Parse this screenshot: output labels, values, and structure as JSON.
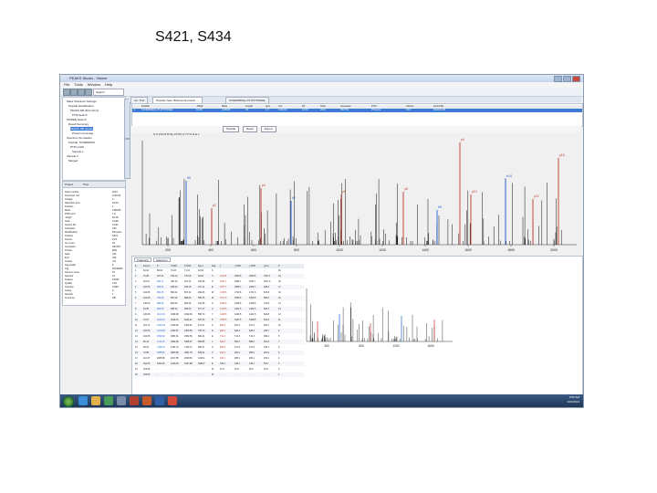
{
  "slide": {
    "title": "S421, S434"
  },
  "window": {
    "title": "PEAKS Studio - Viewer"
  },
  "menu": [
    "File",
    "Tools",
    "Window",
    "Help"
  ],
  "toolbar": {
    "search_placeholder": "Search"
  },
  "tabs": {
    "left": [
      "Summary",
      "Protein",
      "Peptide"
    ],
    "main": [
      "Ion: Prot",
      "Peptide View: Ribosomal protein ...",
      "SVHEMMSA(+79.97)YPKEEL"
    ],
    "lower": [
      "Fragment",
      "Spectrum"
    ],
    "props": [
      "Project",
      "Prop"
    ]
  },
  "tree": [
    "Mass Tolerance Settings",
    "Peptide identification",
    "PEAKS DB 2014-10 [1]",
    "PTM Search",
    "SPIDER Search",
    "Result Summary",
    "PEAKS DB results",
    "Protein Coverage",
    "Spectrum Annotation",
    "Peptide: SVHEMMSA",
    "PTM profile",
    "Sample 1",
    "Sample 2",
    "Merged"
  ],
  "properties": [
    [
      "Scan number",
      "2012"
    ],
    [
      "Precursor m/z",
      "1100.92"
    ],
    [
      "Charge",
      "2"
    ],
    [
      "Retention time",
      "44.53"
    ],
    [
      "Fraction",
      "1"
    ],
    [
      "Mass",
      "2199.83"
    ],
    [
      "PPM error",
      "1.9"
    ],
    [
      "-10lgP",
      "62.48"
    ],
    [
      "Area",
      "4.1E6"
    ],
    [
      "Source file",
      "run01"
    ],
    [
      "Activation",
      "CID"
    ],
    [
      "Modification",
      "Phospho"
    ],
    [
      "Position",
      "S421"
    ],
    [
      "Ascore",
      "23.5"
    ],
    [
      "Ion count",
      "18"
    ],
    [
      "Accession",
      "P62753"
    ],
    [
      "Protein",
      "RS6"
    ],
    [
      "Start",
      "415"
    ],
    [
      "End",
      "434"
    ],
    [
      "Unique",
      "Yes"
    ],
    [
      "Tag length",
      "6"
    ],
    [
      "Tag",
      "SVHEMM"
    ],
    [
      "Denovo score",
      "87"
    ],
    [
      "Spectra",
      "12"
    ],
    [
      "Feature",
      "F2044"
    ],
    [
      "Quality",
      "0.91"
    ],
    [
      "Intensity",
      "2.6E5"
    ],
    [
      "Group",
      "A"
    ],
    [
      "Sample",
      "1"
    ],
    [
      "Found by",
      "DB"
    ]
  ],
  "table": {
    "headers": [
      "",
      "Peptide",
      "-10lgP",
      "Mass",
      "Length",
      "ppm",
      "m/z",
      "RT",
      "Scan",
      "Accession",
      "PTM",
      "AScore",
      "Found By"
    ],
    "selected_row": [
      "1",
      "SVHEMMSA(+79.97)YPKEEL",
      "62.48",
      "2199.83",
      "20",
      "1.9",
      "1100.92",
      "44.53",
      "2012",
      "P62753",
      "Phospho",
      "23.5",
      "PEAKS DB"
    ]
  },
  "spectrum_tools": {
    "btn1": "Peptide",
    "btn2": "Reset",
    "btn3": "Export"
  },
  "spectrum": {
    "sequence_text": "S V H E M M S(+79.97) A Y P K E E L",
    "axis_ticks": [
      "200",
      "400",
      "600",
      "800",
      "1000",
      "1200",
      "1400",
      "1600",
      "1800",
      "2000"
    ],
    "labels": {
      "y2": "y2",
      "b5": "b5",
      "y4": "y4",
      "b7": "b7",
      "y6": "y6",
      "y8": "y8",
      "b9": "b9",
      "y10": "y10",
      "y12": "y12",
      "b14": "b14",
      "y16": "y16",
      "ypeak": "y9"
    }
  },
  "fragment_table": {
    "headers": [
      "#",
      "Immon.",
      "b",
      "b-H2O",
      "b-NH3",
      "b(2+)",
      "Seq",
      "y",
      "y-H2O",
      "y-NH3",
      "y(2+)",
      "#"
    ],
    "rows": [
      [
        "1",
        "60.04",
        "88.04",
        "70.03",
        "71.01",
        "44.52",
        "S",
        "-",
        "-",
        "-",
        "-",
        "20"
      ],
      [
        "2",
        "72.08",
        "187.11",
        "169.10",
        "170.08",
        "94.06",
        "V",
        "2113.8",
        "2095.8",
        "2096.8",
        "1057.4",
        "19"
      ],
      [
        "3",
        "110.07",
        "324.17",
        "306.16",
        "307.14",
        "162.59",
        "H",
        "2014.7",
        "1996.7",
        "1997.7",
        "1007.9",
        "18"
      ],
      [
        "4",
        "102.05",
        "453.21",
        "435.20",
        "436.18",
        "227.11",
        "E",
        "1877.7",
        "1859.7",
        "1860.7",
        "939.3",
        "17"
      ],
      [
        "5",
        "104.05",
        "584.25",
        "566.24",
        "567.22",
        "292.63",
        "M",
        "1748.6",
        "1730.6",
        "1731.6",
        "874.8",
        "16"
      ],
      [
        "6",
        "104.05",
        "715.29",
        "697.28",
        "698.26",
        "358.15",
        "M",
        "1617.6",
        "1599.6",
        "1600.6",
        "809.3",
        "15"
      ],
      [
        "7",
        "140.00",
        "882.29",
        "864.28",
        "865.26",
        "441.65",
        "S",
        "1486.5",
        "1468.5",
        "1469.5",
        "743.8",
        "14"
      ],
      [
        "8",
        "44.05",
        "953.33",
        "935.32",
        "936.30",
        "477.17",
        "A",
        "1319.5",
        "1301.5",
        "1302.5",
        "660.3",
        "13"
      ],
      [
        "9",
        "136.08",
        "1116.39",
        "1098.38",
        "1099.36",
        "558.70",
        "Y",
        "1248.5",
        "1230.5",
        "1231.5",
        "624.8",
        "12"
      ],
      [
        "10",
        "70.07",
        "1213.44",
        "1195.43",
        "1196.41",
        "607.23",
        "P",
        "1085.5",
        "1067.5",
        "1068.5",
        "543.2",
        "11"
      ],
      [
        "11",
        "101.11",
        "1341.54",
        "1323.53",
        "1324.51",
        "671.27",
        "K",
        "988.4",
        "970.4",
        "971.4",
        "494.7",
        "10"
      ],
      [
        "12",
        "102.05",
        "1470.58",
        "1452.57",
        "1453.55",
        "735.79",
        "E",
        "860.3",
        "842.3",
        "843.3",
        "430.7",
        "9"
      ],
      [
        "13",
        "102.05",
        "1599.62",
        "1581.61",
        "1582.59",
        "800.31",
        "E",
        "731.3",
        "713.3",
        "714.3",
        "366.2",
        "8"
      ],
      [
        "14",
        "86.10",
        "1712.70",
        "1694.69",
        "1695.67",
        "856.85",
        "L",
        "602.3",
        "584.3",
        "585.3",
        "301.6",
        "7"
      ],
      [
        "15",
        "60.04",
        "1799.74",
        "1781.73",
        "1782.71",
        "900.37",
        "S",
        "489.2",
        "471.2",
        "472.2",
        "245.1",
        "6"
      ],
      [
        "16",
        "72.08",
        "1898.81",
        "1880.80",
        "1881.78",
        "949.91",
        "V",
        "402.2",
        "384.2",
        "385.2",
        "201.6",
        "5"
      ],
      [
        "17",
        "110.07",
        "2035.86",
        "2017.85",
        "2018.83",
        "1018.4",
        "H",
        "303.1",
        "285.1",
        "286.1",
        "152.1",
        "4"
      ],
      [
        "18",
        "102.05",
        "2164.91",
        "2146.90",
        "2147.88",
        "1082.9",
        "E",
        "166.1",
        "148.1",
        "149.1",
        "83.5",
        "3"
      ],
      [
        "19",
        "104.05",
        "-",
        "-",
        "-",
        "-",
        "M",
        "37.0",
        "19.0",
        "20.0",
        "19.0",
        "2"
      ],
      [
        "20",
        "104.05",
        "-",
        "-",
        "-",
        "-",
        "M",
        "-",
        "-",
        "-",
        "-",
        "1"
      ]
    ]
  },
  "mini_chart": {
    "axis_ticks": [
      "400",
      "800",
      "1200",
      "1600"
    ]
  },
  "taskbar": {
    "time": "9:52 AM",
    "date": "10/2/2014"
  }
}
